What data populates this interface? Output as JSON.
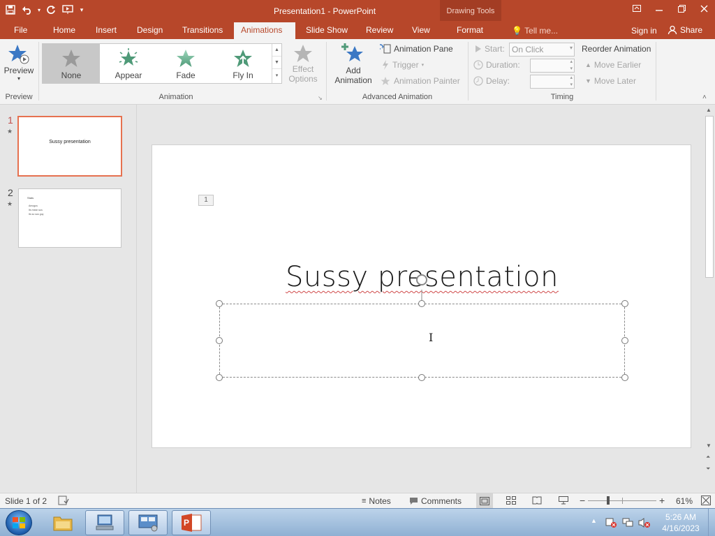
{
  "window": {
    "title": "Presentation1 - PowerPoint",
    "contextual_group": "Drawing Tools",
    "controls": [
      "restore-ribbon",
      "minimize",
      "maximize",
      "close"
    ]
  },
  "qat": {
    "icons": [
      "save-icon",
      "undo-icon",
      "redo-icon",
      "start-from-beginning-icon",
      "customize-qat-icon"
    ]
  },
  "tabs": [
    {
      "label": "File"
    },
    {
      "label": "Home"
    },
    {
      "label": "Insert"
    },
    {
      "label": "Design"
    },
    {
      "label": "Transitions"
    },
    {
      "label": "Animations",
      "active": true
    },
    {
      "label": "Slide Show"
    },
    {
      "label": "Review"
    },
    {
      "label": "View"
    },
    {
      "label": "Format"
    }
  ],
  "tell_me": "Tell me...",
  "sign_in": "Sign in",
  "share": "Share",
  "ribbon": {
    "preview": {
      "button": "Preview",
      "group": "Preview"
    },
    "animation": {
      "group": "Animation",
      "gallery": [
        {
          "label": "None",
          "selected": true,
          "color": "#9a9a9a"
        },
        {
          "label": "Appear",
          "color": "#4f9a78"
        },
        {
          "label": "Fade",
          "color": "#6fbf9a"
        },
        {
          "label": "Fly In",
          "color": "#4f9a78"
        }
      ],
      "effect_options_line1": "Effect",
      "effect_options_line2": "Options"
    },
    "advanced": {
      "group": "Advanced Animation",
      "add_line1": "Add",
      "add_line2": "Animation",
      "animation_pane": "Animation Pane",
      "trigger": "Trigger",
      "animation_painter": "Animation Painter"
    },
    "timing": {
      "group": "Timing",
      "start_label": "Start:",
      "start_value": "On Click",
      "duration_label": "Duration:",
      "delay_label": "Delay:",
      "reorder": "Reorder Animation",
      "move_earlier": "Move Earlier",
      "move_later": "Move Later"
    }
  },
  "thumbnails": [
    {
      "num": "1",
      "title": "Sussy presentation",
      "selected": true
    },
    {
      "num": "2",
      "title": "Stats",
      "bullets": [
        "Amogus",
        "Its mean sus",
        "Its so sus guy"
      ]
    }
  ],
  "slide": {
    "anim_tag": "1",
    "title": "Sussy presentation"
  },
  "status": {
    "slide_of": "Slide 1 of 2",
    "notes": "Notes",
    "comments": "Comments",
    "zoom": "61%"
  },
  "taskbar": {
    "time": "5:26 AM",
    "date": "4/16/2023",
    "apps": [
      "windows-explorer",
      "network-app",
      "control-panel",
      "powerpoint"
    ]
  },
  "colors": {
    "accent": "#b7472a",
    "selection": "#e6714f"
  }
}
